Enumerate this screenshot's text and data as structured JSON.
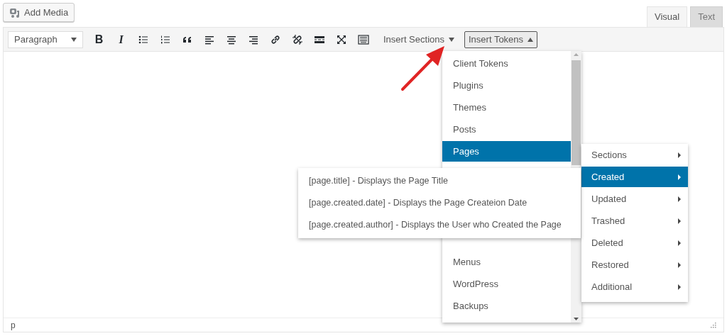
{
  "add_media": "Add Media",
  "tabs": [
    {
      "label": "Visual",
      "selected": true
    },
    {
      "label": "Text",
      "selected": false
    }
  ],
  "format_select": "Paragraph",
  "toolbar": [
    {
      "kind": "bold",
      "label": "B"
    },
    {
      "kind": "italic",
      "label": "I"
    },
    {
      "kind": "bullets"
    },
    {
      "kind": "numbers"
    },
    {
      "kind": "quote"
    },
    {
      "kind": "align-left"
    },
    {
      "kind": "align-center"
    },
    {
      "kind": "align-right"
    },
    {
      "kind": "link"
    },
    {
      "kind": "unlink"
    },
    {
      "kind": "more"
    },
    {
      "kind": "fullscreen"
    },
    {
      "kind": "keyboard"
    }
  ],
  "menus": [
    {
      "label": "Insert Sections",
      "expanded": false
    },
    {
      "label": "Insert Tokens",
      "expanded": true
    }
  ],
  "token_menu": [
    {
      "label": "Client Tokens",
      "selected": false
    },
    {
      "label": "Plugins",
      "selected": false
    },
    {
      "label": "Themes",
      "selected": false
    },
    {
      "label": "Posts",
      "selected": false
    },
    {
      "label": "Pages",
      "selected": true
    },
    {
      "label": "Menus",
      "selected": false
    },
    {
      "label": "WordPress",
      "selected": false
    },
    {
      "label": "Backups",
      "selected": false
    }
  ],
  "submenu": [
    {
      "label": "Sections",
      "selected": false
    },
    {
      "label": "Created",
      "selected": true
    },
    {
      "label": "Updated",
      "selected": false
    },
    {
      "label": "Trashed",
      "selected": false
    },
    {
      "label": "Deleted",
      "selected": false
    },
    {
      "label": "Restored",
      "selected": false
    },
    {
      "label": "Additional",
      "selected": false
    }
  ],
  "tokens": [
    "[page.title] - Displays the Page Title",
    "[page.created.date] - Displays the Page Createion Date",
    "[page.created.author] - Displays the User who Created the Page"
  ],
  "status_bar": "p"
}
